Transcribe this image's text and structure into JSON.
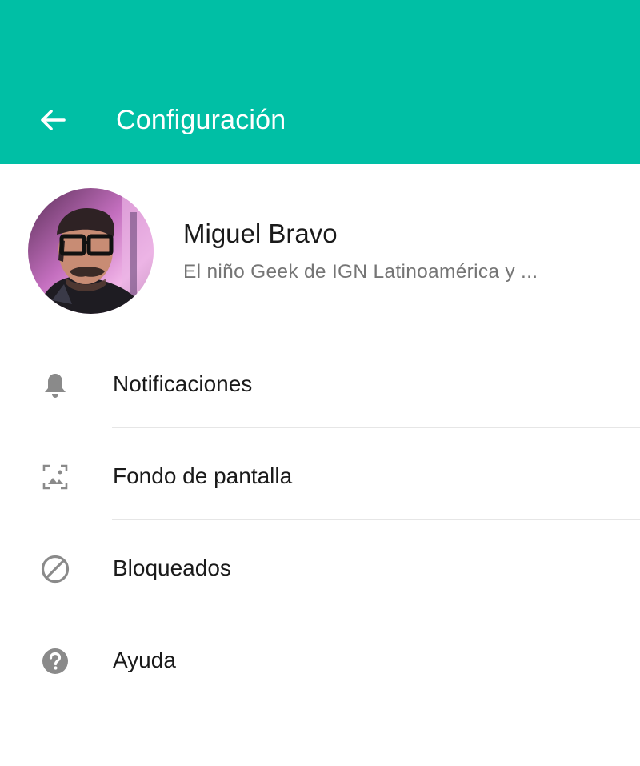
{
  "header": {
    "title": "Configuración",
    "back_icon": "arrow-left-icon",
    "background_color": "#00bfa5"
  },
  "profile": {
    "name": "Miguel Bravo",
    "status": "El niño Geek de IGN Latinoamérica y ..."
  },
  "menu": {
    "items": [
      {
        "label": "Notificaciones",
        "icon": "bell-icon"
      },
      {
        "label": "Fondo de pantalla",
        "icon": "wallpaper-icon"
      },
      {
        "label": "Bloqueados",
        "icon": "block-icon"
      },
      {
        "label": "Ayuda",
        "icon": "help-icon"
      }
    ]
  },
  "colors": {
    "accent": "#00bfa5",
    "icon_gray": "#8a8a8a",
    "secondary_text": "#757575"
  }
}
